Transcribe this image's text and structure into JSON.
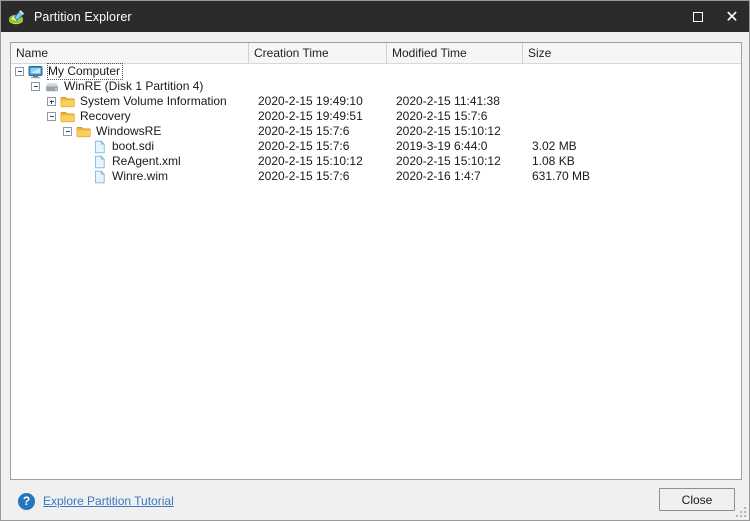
{
  "window": {
    "title": "Partition Explorer",
    "app_icon": "partition-wizard-icon",
    "controls": {
      "maximize": "maximize-icon",
      "close": "close-icon"
    }
  },
  "list": {
    "columns": [
      {
        "key": "name",
        "label": "Name"
      },
      {
        "key": "creation_time",
        "label": "Creation Time"
      },
      {
        "key": "modified_time",
        "label": "Modified Time"
      },
      {
        "key": "size",
        "label": "Size"
      }
    ],
    "rows": [
      {
        "name": "My Computer",
        "icon": "computer-icon",
        "depth": 0,
        "expander": "minus",
        "focused": true,
        "creation_time": "",
        "modified_time": "",
        "size": ""
      },
      {
        "name": "WinRE (Disk 1 Partition 4)",
        "icon": "drive-icon",
        "depth": 1,
        "expander": "minus",
        "focused": false,
        "creation_time": "",
        "modified_time": "",
        "size": ""
      },
      {
        "name": "System Volume Information",
        "icon": "folder-icon",
        "depth": 2,
        "expander": "plus",
        "focused": false,
        "creation_time": "2020-2-15 19:49:10",
        "modified_time": "2020-2-15 11:41:38",
        "size": ""
      },
      {
        "name": "Recovery",
        "icon": "folder-icon",
        "depth": 2,
        "expander": "minus",
        "focused": false,
        "creation_time": "2020-2-15 19:49:51",
        "modified_time": "2020-2-15 15:7:6",
        "size": ""
      },
      {
        "name": "WindowsRE",
        "icon": "folder-icon",
        "depth": 3,
        "expander": "minus",
        "focused": false,
        "creation_time": "2020-2-15 15:7:6",
        "modified_time": "2020-2-15 15:10:12",
        "size": ""
      },
      {
        "name": "boot.sdi",
        "icon": "file-icon",
        "depth": 4,
        "expander": "none",
        "focused": false,
        "creation_time": "2020-2-15 15:7:6",
        "modified_time": "2019-3-19 6:44:0",
        "size": "3.02 MB"
      },
      {
        "name": "ReAgent.xml",
        "icon": "file-icon",
        "depth": 4,
        "expander": "none",
        "focused": false,
        "creation_time": "2020-2-15 15:10:12",
        "modified_time": "2020-2-15 15:10:12",
        "size": "1.08 KB"
      },
      {
        "name": "Winre.wim",
        "icon": "file-icon",
        "depth": 4,
        "expander": "none",
        "focused": false,
        "creation_time": "2020-2-15 15:7:6",
        "modified_time": "2020-2-16 1:4:7",
        "size": "631.70 MB"
      }
    ]
  },
  "footer": {
    "help_icon": "help-question-icon",
    "tutorial_link": "Explore Partition Tutorial",
    "close_label": "Close"
  },
  "colors": {
    "titlebar_bg": "#2b2b2b",
    "dialog_bg": "#f0f0f0",
    "list_bg": "#ffffff",
    "link": "#3a78c2",
    "help_badge": "#2676bd",
    "folder": "#f6c141"
  }
}
